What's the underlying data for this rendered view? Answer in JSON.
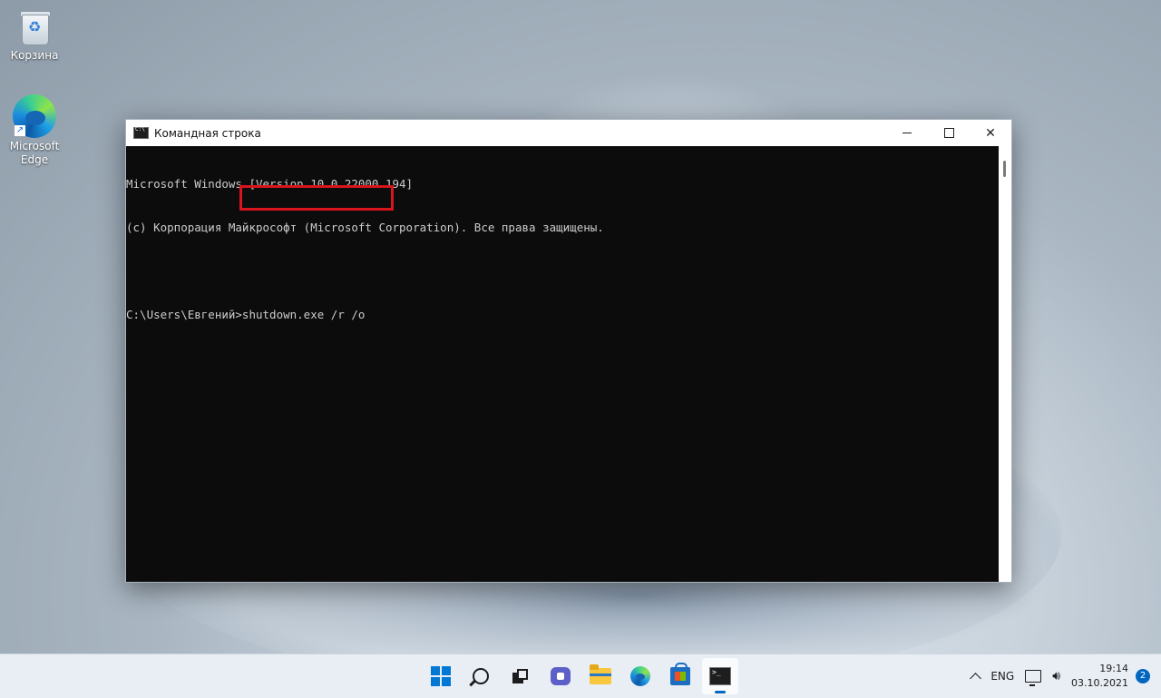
{
  "desktop": {
    "icons": [
      {
        "label": "Корзина",
        "icon": "recycle-bin-icon"
      },
      {
        "label": "Microsoft Edge",
        "icon": "edge-icon"
      }
    ]
  },
  "window": {
    "title": "Командная строка",
    "controls": {
      "minimize": "minimize-icon",
      "maximize": "maximize-icon",
      "close": "close-icon"
    },
    "console": {
      "lines": [
        "Microsoft Windows [Version 10.0.22000.194]",
        "(c) Корпорация Майкрософт (Microsoft Corporation). Все права защищены.",
        "",
        "C:\\Users\\Евгений>shutdown.exe /r /o"
      ]
    },
    "highlight_color": "#d8141c"
  },
  "taskbar": {
    "apps": [
      "start-icon",
      "search-icon",
      "task-view-icon",
      "chat-icon",
      "file-explorer-icon",
      "edge-icon",
      "store-icon",
      "terminal-icon"
    ],
    "tray": {
      "language": "ENG",
      "time": "19:14",
      "date": "03.10.2021",
      "notifications": "2"
    }
  }
}
